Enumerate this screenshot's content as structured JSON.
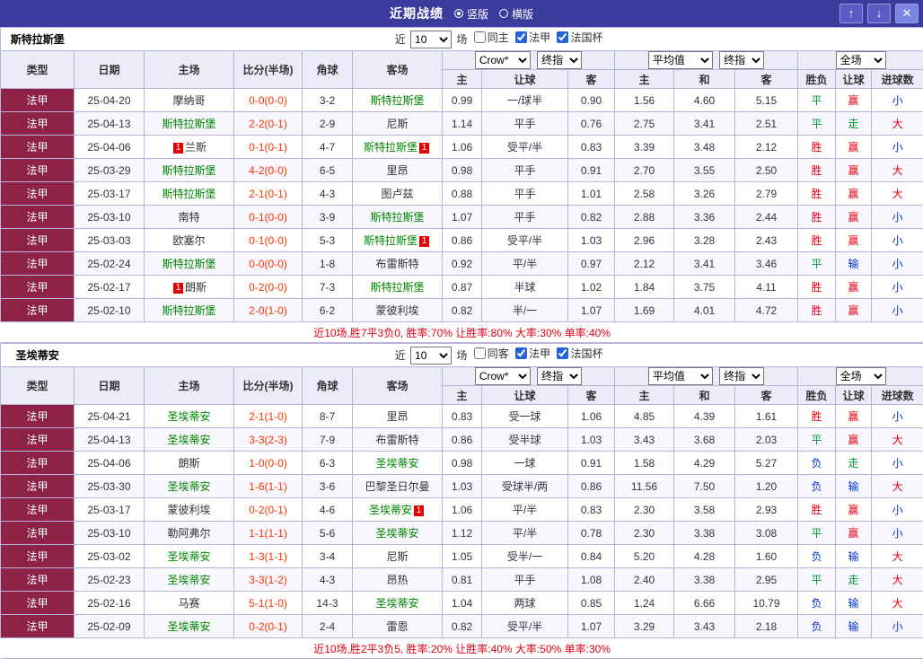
{
  "colors": {
    "titlebar_bg": "#3b3b9e",
    "league_badge_bg": "#8e2246",
    "header_bg": "#ececf8",
    "border": "#b4b4dd",
    "team_highlight_green": "#008800",
    "score_red": "#ff3300",
    "win_red": "#e60012",
    "draw_green": "#009933",
    "lose_blue": "#0033cc"
  },
  "titlebar": {
    "title": "近期战绩",
    "radios": [
      {
        "label": "竖版",
        "selected": true
      },
      {
        "label": "横版",
        "selected": false
      }
    ],
    "buttons": {
      "up": "↑",
      "down": "↓",
      "close": "✕"
    }
  },
  "columns": [
    "类型",
    "日期",
    "主场",
    "比分(半场)",
    "角球",
    "客场",
    "主",
    "让球",
    "客",
    "主",
    "和",
    "客",
    "胜负",
    "让球",
    "进球数"
  ],
  "dropdowns": {
    "book": "Crow*",
    "book_final": "终指",
    "avg": "平均值",
    "avg_final": "终指",
    "scope": "全场"
  },
  "tables": [
    {
      "team": "斯特拉斯堡",
      "filter": {
        "near": "近",
        "count": "10",
        "games": "场",
        "same": "同主",
        "same_checked": false,
        "league": "法甲",
        "league_checked": true,
        "cup": "法国杯",
        "cup_checked": true
      },
      "summary": "近10场,胜7平3负0, 胜率:70% 让胜率:80% 大率:30% 单率:40%",
      "rows": [
        {
          "league": "法甲",
          "date": "25-04-20",
          "home": "摩纳哥",
          "home_badge": "",
          "home_hl": false,
          "score": "0-0(0-0)",
          "corner": "3-2",
          "away": "斯特拉斯堡",
          "away_badge": "",
          "away_hl": true,
          "odds": [
            "0.99",
            "一/球半",
            "0.90"
          ],
          "euro": [
            "1.56",
            "4.60",
            "5.15"
          ],
          "result": "平",
          "handicap_result": "赢",
          "goals": "小"
        },
        {
          "league": "法甲",
          "date": "25-04-13",
          "home": "斯特拉斯堡",
          "home_badge": "",
          "home_hl": true,
          "score": "2-2(0-1)",
          "corner": "2-9",
          "away": "尼斯",
          "away_badge": "",
          "away_hl": false,
          "odds": [
            "1.14",
            "平手",
            "0.76"
          ],
          "euro": [
            "2.75",
            "3.41",
            "2.51"
          ],
          "result": "平",
          "handicap_result": "走",
          "goals": "大"
        },
        {
          "league": "法甲",
          "date": "25-04-06",
          "home": "兰斯",
          "home_badge": "1",
          "home_hl": false,
          "score": "0-1(0-1)",
          "corner": "4-7",
          "away": "斯特拉斯堡",
          "away_badge": "1",
          "away_hl": true,
          "odds": [
            "1.06",
            "受平/半",
            "0.83"
          ],
          "euro": [
            "3.39",
            "3.48",
            "2.12"
          ],
          "result": "胜",
          "handicap_result": "赢",
          "goals": "小"
        },
        {
          "league": "法甲",
          "date": "25-03-29",
          "home": "斯特拉斯堡",
          "home_badge": "",
          "home_hl": true,
          "score": "4-2(0-0)",
          "corner": "6-5",
          "away": "里昂",
          "away_badge": "",
          "away_hl": false,
          "odds": [
            "0.98",
            "平手",
            "0.91"
          ],
          "euro": [
            "2.70",
            "3.55",
            "2.50"
          ],
          "result": "胜",
          "handicap_result": "赢",
          "goals": "大"
        },
        {
          "league": "法甲",
          "date": "25-03-17",
          "home": "斯特拉斯堡",
          "home_badge": "",
          "home_hl": true,
          "score": "2-1(0-1)",
          "corner": "4-3",
          "away": "图卢兹",
          "away_badge": "",
          "away_hl": false,
          "odds": [
            "0.88",
            "平手",
            "1.01"
          ],
          "euro": [
            "2.58",
            "3.26",
            "2.79"
          ],
          "result": "胜",
          "handicap_result": "赢",
          "goals": "大"
        },
        {
          "league": "法甲",
          "date": "25-03-10",
          "home": "南特",
          "home_badge": "",
          "home_hl": false,
          "score": "0-1(0-0)",
          "corner": "3-9",
          "away": "斯特拉斯堡",
          "away_badge": "",
          "away_hl": true,
          "odds": [
            "1.07",
            "平手",
            "0.82"
          ],
          "euro": [
            "2.88",
            "3.36",
            "2.44"
          ],
          "result": "胜",
          "handicap_result": "赢",
          "goals": "小"
        },
        {
          "league": "法甲",
          "date": "25-03-03",
          "home": "欧塞尔",
          "home_badge": "",
          "home_hl": false,
          "score": "0-1(0-0)",
          "corner": "5-3",
          "away": "斯特拉斯堡",
          "away_badge": "1",
          "away_hl": true,
          "odds": [
            "0.86",
            "受平/半",
            "1.03"
          ],
          "euro": [
            "2.96",
            "3.28",
            "2.43"
          ],
          "result": "胜",
          "handicap_result": "赢",
          "goals": "小"
        },
        {
          "league": "法甲",
          "date": "25-02-24",
          "home": "斯特拉斯堡",
          "home_badge": "",
          "home_hl": true,
          "score": "0-0(0-0)",
          "corner": "1-8",
          "away": "布雷斯特",
          "away_badge": "",
          "away_hl": false,
          "odds": [
            "0.92",
            "平/半",
            "0.97"
          ],
          "euro": [
            "2.12",
            "3.41",
            "3.46"
          ],
          "result": "平",
          "handicap_result": "输",
          "goals": "小"
        },
        {
          "league": "法甲",
          "date": "25-02-17",
          "home": "朗斯",
          "home_badge": "1",
          "home_hl": false,
          "score": "0-2(0-0)",
          "corner": "7-3",
          "away": "斯特拉斯堡",
          "away_badge": "",
          "away_hl": true,
          "odds": [
            "0.87",
            "半球",
            "1.02"
          ],
          "euro": [
            "1.84",
            "3.75",
            "4.11"
          ],
          "result": "胜",
          "handicap_result": "赢",
          "goals": "小"
        },
        {
          "league": "法甲",
          "date": "25-02-10",
          "home": "斯特拉斯堡",
          "home_badge": "",
          "home_hl": true,
          "score": "2-0(1-0)",
          "corner": "6-2",
          "away": "蒙彼利埃",
          "away_badge": "",
          "away_hl": false,
          "odds": [
            "0.82",
            "半/一",
            "1.07"
          ],
          "euro": [
            "1.69",
            "4.01",
            "4.72"
          ],
          "result": "胜",
          "handicap_result": "赢",
          "goals": "小"
        }
      ]
    },
    {
      "team": "圣埃蒂安",
      "filter": {
        "near": "近",
        "count": "10",
        "games": "场",
        "same": "同客",
        "same_checked": false,
        "league": "法甲",
        "league_checked": true,
        "cup": "法国杯",
        "cup_checked": true
      },
      "summary": "近10场,胜2平3负5, 胜率:20% 让胜率:40% 大率:50% 单率:30%",
      "rows": [
        {
          "league": "法甲",
          "date": "25-04-21",
          "home": "圣埃蒂安",
          "home_badge": "",
          "home_hl": true,
          "score": "2-1(1-0)",
          "corner": "8-7",
          "away": "里昂",
          "away_badge": "",
          "away_hl": false,
          "odds": [
            "0.83",
            "受一球",
            "1.06"
          ],
          "euro": [
            "4.85",
            "4.39",
            "1.61"
          ],
          "result": "胜",
          "handicap_result": "赢",
          "goals": "小"
        },
        {
          "league": "法甲",
          "date": "25-04-13",
          "home": "圣埃蒂安",
          "home_badge": "",
          "home_hl": true,
          "score": "3-3(2-3)",
          "corner": "7-9",
          "away": "布雷斯特",
          "away_badge": "",
          "away_hl": false,
          "odds": [
            "0.86",
            "受半球",
            "1.03"
          ],
          "euro": [
            "3.43",
            "3.68",
            "2.03"
          ],
          "result": "平",
          "handicap_result": "赢",
          "goals": "大"
        },
        {
          "league": "法甲",
          "date": "25-04-06",
          "home": "朗斯",
          "home_badge": "",
          "home_hl": false,
          "score": "1-0(0-0)",
          "corner": "6-3",
          "away": "圣埃蒂安",
          "away_badge": "",
          "away_hl": true,
          "odds": [
            "0.98",
            "一球",
            "0.91"
          ],
          "euro": [
            "1.58",
            "4.29",
            "5.27"
          ],
          "result": "负",
          "handicap_result": "走",
          "goals": "小"
        },
        {
          "league": "法甲",
          "date": "25-03-30",
          "home": "圣埃蒂安",
          "home_badge": "",
          "home_hl": true,
          "score": "1-6(1-1)",
          "corner": "3-6",
          "away": "巴黎圣日尔曼",
          "away_badge": "",
          "away_hl": false,
          "odds": [
            "1.03",
            "受球半/两",
            "0.86"
          ],
          "euro": [
            "11.56",
            "7.50",
            "1.20"
          ],
          "result": "负",
          "handicap_result": "输",
          "goals": "大"
        },
        {
          "league": "法甲",
          "date": "25-03-17",
          "home": "蒙彼利埃",
          "home_badge": "",
          "home_hl": false,
          "score": "0-2(0-1)",
          "corner": "4-6",
          "away": "圣埃蒂安",
          "away_badge": "1",
          "away_hl": true,
          "odds": [
            "1.06",
            "平/半",
            "0.83"
          ],
          "euro": [
            "2.30",
            "3.58",
            "2.93"
          ],
          "result": "胜",
          "handicap_result": "赢",
          "goals": "小"
        },
        {
          "league": "法甲",
          "date": "25-03-10",
          "home": "勒阿弗尔",
          "home_badge": "",
          "home_hl": false,
          "score": "1-1(1-1)",
          "corner": "5-6",
          "away": "圣埃蒂安",
          "away_badge": "",
          "away_hl": true,
          "odds": [
            "1.12",
            "平/半",
            "0.78"
          ],
          "euro": [
            "2.30",
            "3.38",
            "3.08"
          ],
          "result": "平",
          "handicap_result": "赢",
          "goals": "小"
        },
        {
          "league": "法甲",
          "date": "25-03-02",
          "home": "圣埃蒂安",
          "home_badge": "",
          "home_hl": true,
          "score": "1-3(1-1)",
          "corner": "3-4",
          "away": "尼斯",
          "away_badge": "",
          "away_hl": false,
          "odds": [
            "1.05",
            "受半/一",
            "0.84"
          ],
          "euro": [
            "5.20",
            "4.28",
            "1.60"
          ],
          "result": "负",
          "handicap_result": "输",
          "goals": "大"
        },
        {
          "league": "法甲",
          "date": "25-02-23",
          "home": "圣埃蒂安",
          "home_badge": "",
          "home_hl": true,
          "score": "3-3(1-2)",
          "corner": "4-3",
          "away": "昂热",
          "away_badge": "",
          "away_hl": false,
          "odds": [
            "0.81",
            "平手",
            "1.08"
          ],
          "euro": [
            "2.40",
            "3.38",
            "2.95"
          ],
          "result": "平",
          "handicap_result": "走",
          "goals": "大"
        },
        {
          "league": "法甲",
          "date": "25-02-16",
          "home": "马赛",
          "home_badge": "",
          "home_hl": false,
          "score": "5-1(1-0)",
          "corner": "14-3",
          "away": "圣埃蒂安",
          "away_badge": "",
          "away_hl": true,
          "odds": [
            "1.04",
            "两球",
            "0.85"
          ],
          "euro": [
            "1.24",
            "6.66",
            "10.79"
          ],
          "result": "负",
          "handicap_result": "输",
          "goals": "大"
        },
        {
          "league": "法甲",
          "date": "25-02-09",
          "home": "圣埃蒂安",
          "home_badge": "",
          "home_hl": true,
          "score": "0-2(0-1)",
          "corner": "2-4",
          "away": "雷恩",
          "away_badge": "",
          "away_hl": false,
          "odds": [
            "0.82",
            "受平/半",
            "1.07"
          ],
          "euro": [
            "3.29",
            "3.43",
            "2.18"
          ],
          "result": "负",
          "handicap_result": "输",
          "goals": "小"
        }
      ]
    }
  ]
}
